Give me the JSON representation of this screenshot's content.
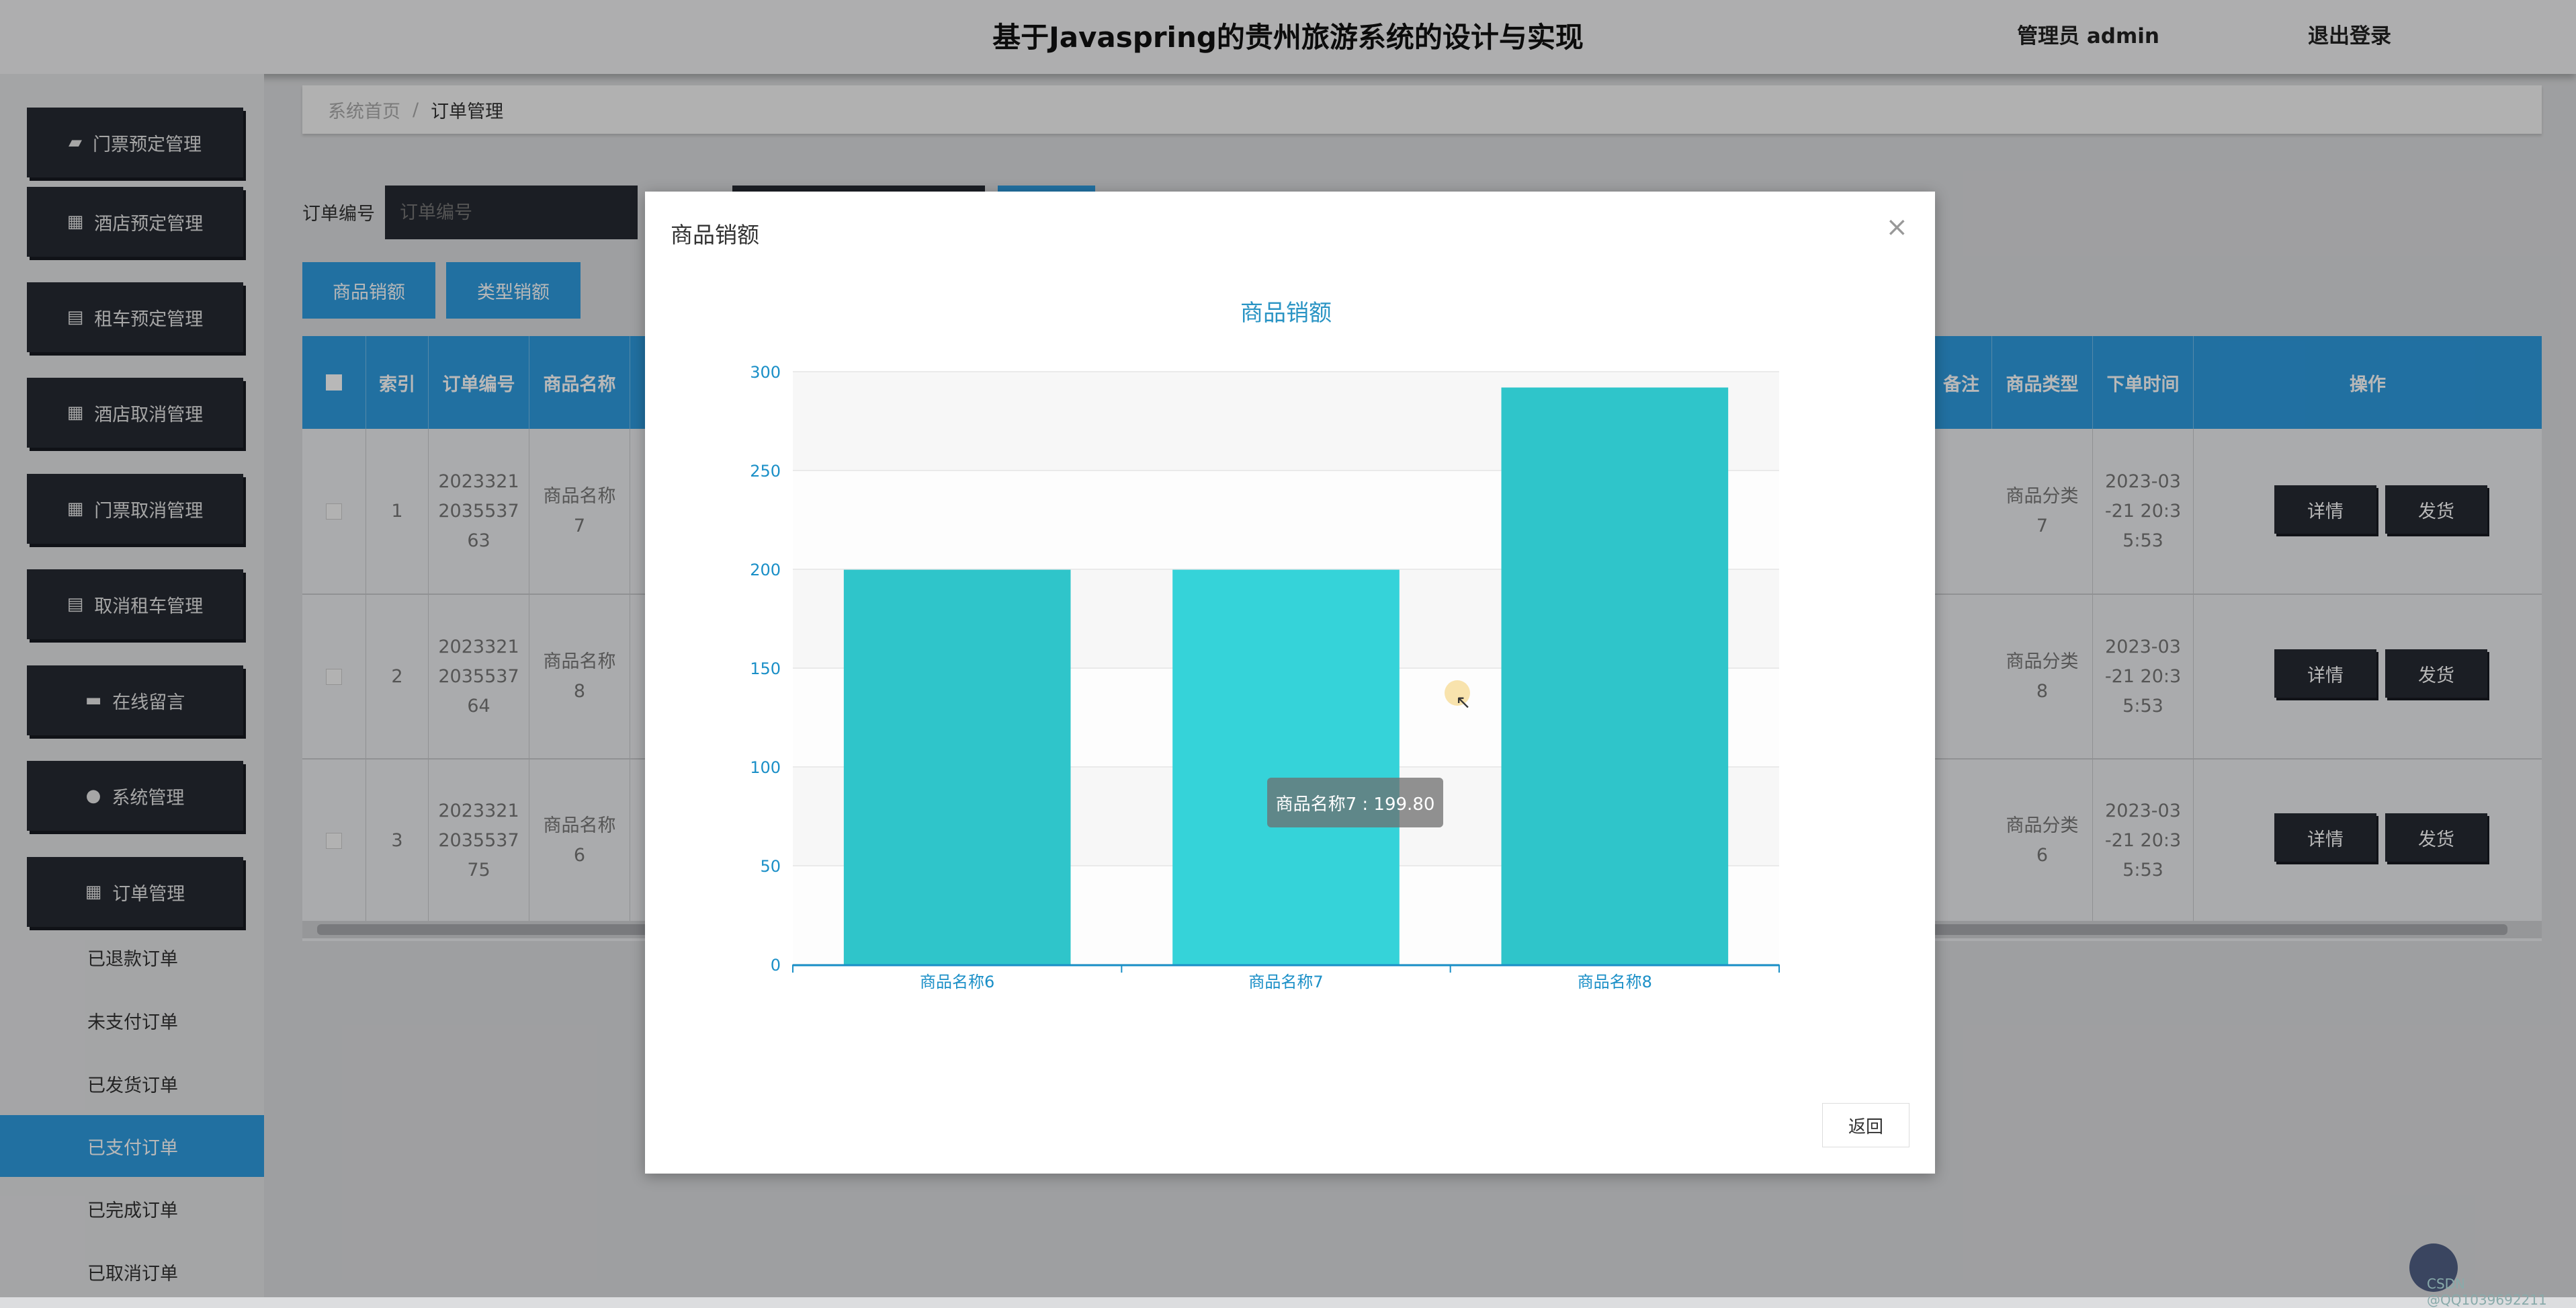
{
  "header": {
    "title": "基于Javaspring的贵州旅游系统的设计与实现",
    "user": "管理员 admin",
    "logout": "退出登录"
  },
  "sidebar": {
    "menu": [
      {
        "label": "门票预定管理",
        "icon": "ticket-icon"
      },
      {
        "label": "酒店预定管理",
        "icon": "grid-icon"
      },
      {
        "label": "租车预定管理",
        "icon": "clipboard-icon"
      },
      {
        "label": "酒店取消管理",
        "icon": "grid-icon"
      },
      {
        "label": "门票取消管理",
        "icon": "grid-icon"
      },
      {
        "label": "取消租车管理",
        "icon": "clipboard-icon"
      },
      {
        "label": "在线留言",
        "icon": "chat-icon"
      },
      {
        "label": "系统管理",
        "icon": "user-icon"
      },
      {
        "label": "订单管理",
        "icon": "grid-icon"
      }
    ],
    "sub": [
      "已退款订单",
      "未支付订单",
      "已发货订单",
      "已支付订单",
      "已完成订单",
      "已取消订单"
    ],
    "active_sub": "已支付订单"
  },
  "breadcrumb": {
    "home": "系统首页",
    "separator": "/",
    "current": "订单管理"
  },
  "search": {
    "label": "订单编号",
    "placeholder": "订单编号"
  },
  "toolbar": {
    "btn1": "商品销额",
    "btn2": "类型销额"
  },
  "table": {
    "headers": [
      "索引",
      "订单编号",
      "商品名称",
      "备注",
      "商品类型",
      "下单时间",
      "操作"
    ],
    "rows": [
      {
        "index": "1",
        "order_no": "2023321 2035537 63",
        "product": "商品名称 7",
        "type": "商品分类 7",
        "time": "2023-03 -21 20:3 5:53"
      },
      {
        "index": "2",
        "order_no": "2023321 2035537 64",
        "product": "商品名称 8",
        "type": "商品分类 8",
        "time": "2023-03 -21 20:3 5:53"
      },
      {
        "index": "3",
        "order_no": "2023321 2035537 75",
        "product": "商品名称 6",
        "type": "商品分类 6",
        "time": "2023-03 -21 20:3 5:53"
      }
    ],
    "detail_label": "详情",
    "ship_label": "发货"
  },
  "modal": {
    "title": "商品销额",
    "close": "×",
    "return_label": "返回",
    "tooltip": "商品名称7 : 199.80"
  },
  "chart_data": {
    "type": "bar",
    "title": "商品销额",
    "categories": [
      "商品名称6",
      "商品名称7",
      "商品名称8"
    ],
    "values": [
      199.8,
      199.8,
      292
    ],
    "ylim": [
      0,
      300
    ],
    "yticks": [
      0,
      50,
      100,
      150,
      200,
      250,
      300
    ],
    "grid": true,
    "colors": {
      "bar": "#2fc5ca",
      "bar_highlight": "#35d3d9",
      "axis": "#1a8fc7",
      "title": "#2a94c4"
    }
  },
  "watermark": "CSDN @QQ1039692211"
}
